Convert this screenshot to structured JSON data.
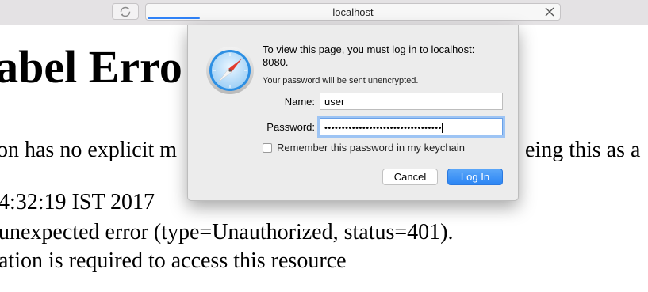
{
  "browser": {
    "address": "localhost"
  },
  "page": {
    "heading": "label Erro",
    "line1": "on has no explicit m",
    "line1_right": "eing this as a",
    "timestamp": "4:32:19 IST 2017",
    "error_line": "unexpected error (type=Unauthorized, status=401).",
    "message_line": "ation is required to access this resource"
  },
  "dialog": {
    "message": "To view this page, you must log in to localhost: 8080.",
    "subtext": "Your password will be sent unencrypted.",
    "name_label": "Name:",
    "name_value": "user",
    "password_label": "Password:",
    "password_mask": "••••••••••••••••••••••••••••••••••",
    "remember_label": "Remember this password in my keychain",
    "remember_checked": false,
    "cancel_label": "Cancel",
    "login_label": "Log In",
    "icon": "safari-compass-icon"
  },
  "colors": {
    "accent": "#2f82f7",
    "login_button": "#2b85f4",
    "focus_ring": "#9dc4f4"
  }
}
